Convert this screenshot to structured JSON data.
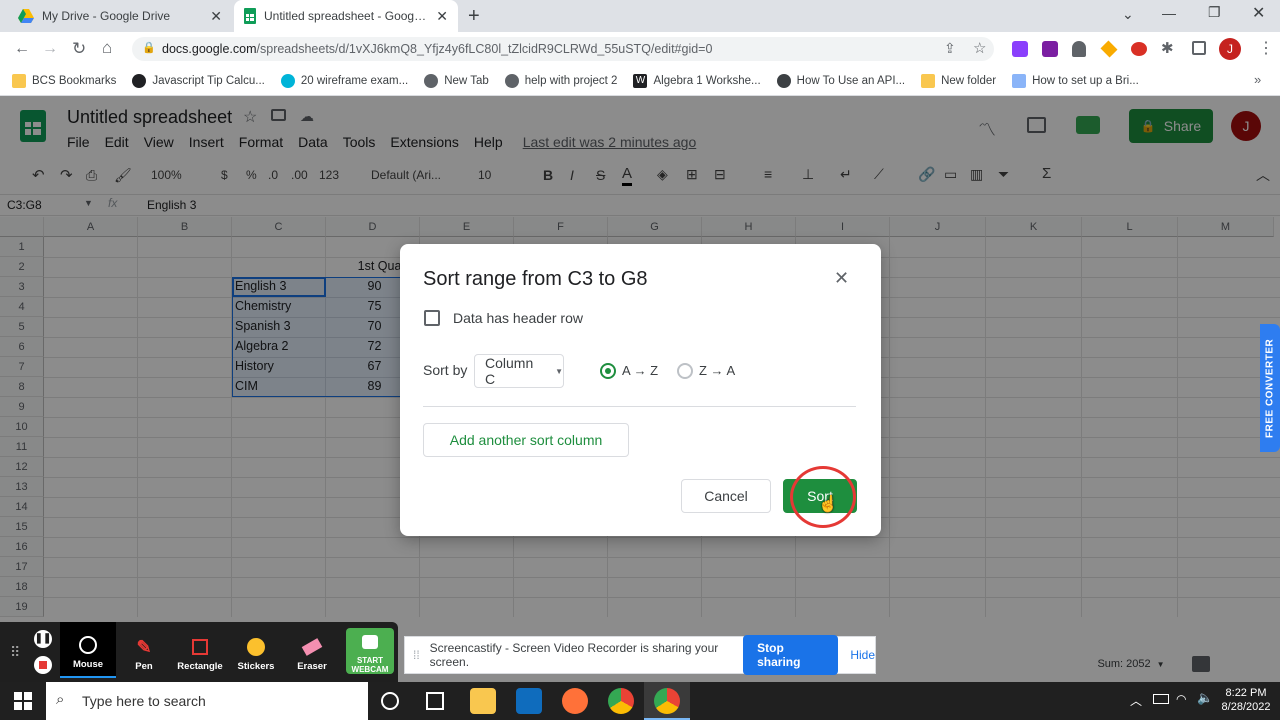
{
  "browser": {
    "tabs": [
      {
        "title": "My Drive - Google Drive",
        "icon": "drive-icon"
      },
      {
        "title": "Untitled spreadsheet - Google Sh",
        "icon": "sheets-icon"
      }
    ],
    "url_domain": "docs.google.com",
    "url_path": "/spreadsheets/d/1vXJ6kmQ8_Yfjz4y6fLC80l_tZlcidR9CLRWd_55uSTQ/edit#gid=0",
    "avatar_letter": "J",
    "bookmarks": [
      "BCS Bookmarks",
      "Javascript Tip Calcu...",
      "20 wireframe exam...",
      "New Tab",
      "help with project 2",
      "Algebra 1 Workshe...",
      "How To Use an API...",
      "New folder",
      "How to set up a Bri..."
    ]
  },
  "sheets": {
    "doc_title": "Untitled spreadsheet",
    "menu": [
      "File",
      "Edit",
      "View",
      "Insert",
      "Format",
      "Data",
      "Tools",
      "Extensions",
      "Help"
    ],
    "last_edit": "Last edit was 2 minutes ago",
    "share_label": "Share",
    "user_letter": "J",
    "toolbar": {
      "zoom": "100%",
      "currency": "$",
      "percent": "%",
      "dec_less": ".0",
      "dec_more": ".00",
      "format_more": "123",
      "font": "Default (Ari...",
      "font_size": "10"
    },
    "name_box": "C3:G8",
    "formula": "English 3",
    "columns": [
      "A",
      "B",
      "C",
      "D",
      "E",
      "F",
      "G",
      "H",
      "I",
      "J",
      "K",
      "L",
      "M"
    ],
    "rows": [
      "1",
      "2",
      "3",
      "4",
      "5",
      "6",
      "7",
      "8",
      "9",
      "10",
      "11",
      "12",
      "13",
      "14",
      "15",
      "16",
      "17",
      "18",
      "19"
    ],
    "d2_header": "1st Quarte",
    "data_rows": [
      {
        "subject": "English 3",
        "score": "90"
      },
      {
        "subject": "Chemistry",
        "score": "75"
      },
      {
        "subject": "Spanish 3",
        "score": "70"
      },
      {
        "subject": "Algebra 2",
        "score": "72"
      },
      {
        "subject": "History",
        "score": "67"
      },
      {
        "subject": "CIM",
        "score": "89"
      }
    ],
    "sum_label": "Sum: 2052"
  },
  "dialog": {
    "title": "Sort range from C3 to G8",
    "header_checkbox_label": "Data has header row",
    "header_checked": false,
    "sort_by_label": "Sort by",
    "sort_column": "Column C",
    "order_az": "A → Z",
    "order_za": "Z → A",
    "selected_order": "az",
    "add_sort_label": "Add another sort column",
    "cancel_label": "Cancel",
    "sort_label": "Sort"
  },
  "screencastify": {
    "tools": [
      {
        "label": "Mouse",
        "icon": "mouse-icon"
      },
      {
        "label": "Pen",
        "icon": "pen-icon"
      },
      {
        "label": "Rectangle",
        "icon": "rectangle-icon"
      },
      {
        "label": "Stickers",
        "icon": "sticker-icon"
      },
      {
        "label": "Eraser",
        "icon": "eraser-icon"
      },
      {
        "label": "START WEBCAM",
        "icon": "webcam-icon"
      }
    ],
    "sharing_text": "Screencastify - Screen Video Recorder is sharing your screen.",
    "stop_label": "Stop sharing",
    "hide_label": "Hide"
  },
  "side_tab": "FREE CONVERTER",
  "taskbar": {
    "search_placeholder": "Type here to search",
    "time": "8:22 PM",
    "date": "8/28/2022"
  },
  "colors": {
    "sheets_green": "#188038",
    "dialog_blue": "#1a73e8",
    "share_green": "#1e8e3e"
  }
}
